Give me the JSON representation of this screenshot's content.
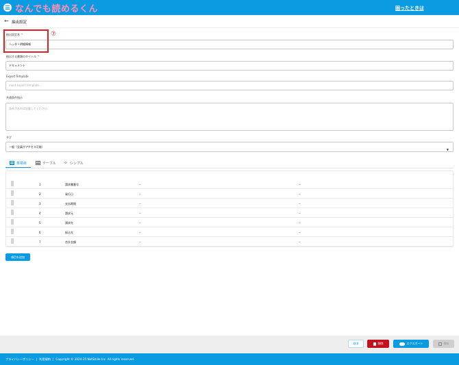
{
  "header": {
    "logo_text": "なんでも読めるくん",
    "help_link": "困ったときは"
  },
  "page": {
    "title": "抽出設定"
  },
  "annotation": {
    "number": "⑦"
  },
  "fields": {
    "setting_name": {
      "label": "抽出設定名",
      "required_mark": "*",
      "value": "ヘッダ＋明細情報"
    },
    "doc_title": {
      "label": "抽出する書類のタイトル",
      "required_mark": "*",
      "value": "ドキュメント"
    },
    "export_template": {
      "label": "Export Template",
      "placeholder": "input export template..."
    },
    "common_instruction": {
      "label": "共通条件指示",
      "placeholder": "条件があれば記載してください"
    },
    "tag": {
      "label": "タグ",
      "value": "一般（全員がアクセス可能）"
    }
  },
  "tabs": [
    {
      "label": "単項目",
      "active": true
    },
    {
      "label": "テーブル",
      "active": false
    },
    {
      "label": "シンプル",
      "active": false
    }
  ],
  "items": [
    {
      "num": "1",
      "name": "請求書番号",
      "c1": "--",
      "c2": "--"
    },
    {
      "num": "2",
      "name": "発行日",
      "c1": "--",
      "c2": "--"
    },
    {
      "num": "3",
      "name": "支払期限",
      "c1": "--",
      "c2": "--"
    },
    {
      "num": "4",
      "name": "請求元",
      "c1": "--",
      "c2": "--"
    },
    {
      "num": "5",
      "name": "請求先",
      "c1": "--",
      "c2": "--"
    },
    {
      "num": "6",
      "name": "振込先",
      "c1": "--",
      "c2": "--"
    },
    {
      "num": "7",
      "name": "合計金額",
      "c1": "--",
      "c2": "--"
    }
  ],
  "add_item_button": "項目を追加",
  "actions": {
    "cancel": "取消",
    "delete": "削除",
    "export": "エクスポート",
    "save": "保存"
  },
  "footer": {
    "privacy": "プライバシーポリシー",
    "sep1": "|",
    "terms": "利用規約",
    "sep2": "|",
    "copyright": "Copyright © 2024-25 NetSmile Inc. All rights reserved."
  },
  "colors": {
    "brand_blue": "#0b9be0",
    "delete_red": "#c1121f",
    "annotation_red": "#e02020"
  }
}
